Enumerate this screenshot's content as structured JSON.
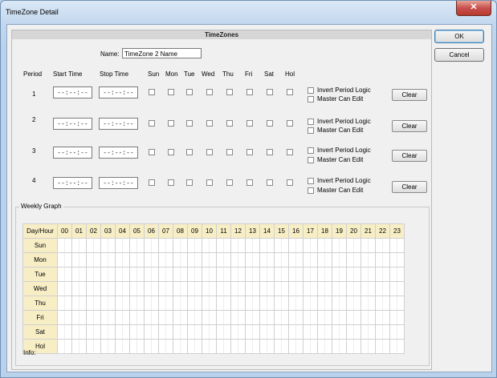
{
  "window": {
    "title": "TimeZone Detail",
    "close_glyph": "✕"
  },
  "panel": {
    "title": "TimeZones"
  },
  "name": {
    "label": "Name:",
    "value": "TimeZone 2 Name"
  },
  "headers": {
    "period": "Period",
    "start": "Start Time",
    "stop": "Stop Time",
    "days": [
      "Sun",
      "Mon",
      "Tue",
      "Wed",
      "Thu",
      "Fri",
      "Sat",
      "Hol"
    ]
  },
  "periods": [
    {
      "number": "1",
      "start": "--:--:--",
      "stop": "--:--:--"
    },
    {
      "number": "2",
      "start": "--:--:--",
      "stop": "--:--:--"
    },
    {
      "number": "3",
      "start": "--:--:--",
      "stop": "--:--:--"
    },
    {
      "number": "4",
      "start": "--:--:--",
      "stop": "--:--:--"
    }
  ],
  "period_options": {
    "invert": "Invert Period Logic",
    "master": "Master Can Edit",
    "clear": "Clear"
  },
  "graph": {
    "legend": "Weekly Graph",
    "corner": "Day/Hour",
    "hours": [
      "00",
      "01",
      "02",
      "03",
      "04",
      "05",
      "06",
      "07",
      "08",
      "09",
      "10",
      "11",
      "12",
      "13",
      "14",
      "15",
      "16",
      "17",
      "18",
      "19",
      "20",
      "21",
      "22",
      "23"
    ],
    "days": [
      "Sun",
      "Mon",
      "Tue",
      "Wed",
      "Thu",
      "Fri",
      "Sat",
      "Hol"
    ]
  },
  "info": {
    "label": "Info:"
  },
  "buttons": {
    "ok": "OK",
    "cancel": "Cancel"
  },
  "colors": {
    "grid_header": "#f7eec6",
    "close": "#c75050"
  }
}
